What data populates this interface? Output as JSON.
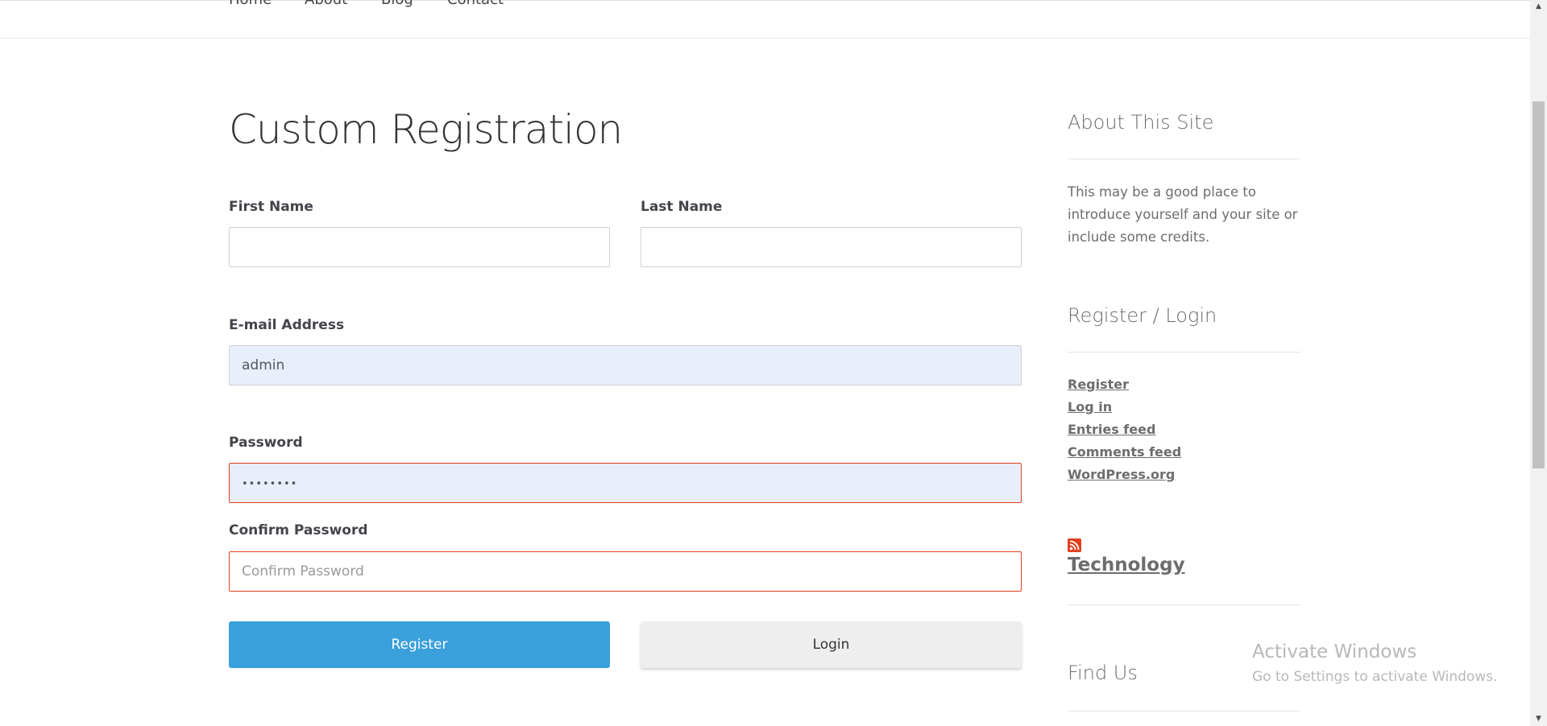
{
  "nav": {
    "items": [
      "Home",
      "About",
      "Blog",
      "Contact"
    ]
  },
  "page": {
    "title": "Custom Registration"
  },
  "form": {
    "first_name": {
      "label": "First Name",
      "value": ""
    },
    "last_name": {
      "label": "Last Name",
      "value": ""
    },
    "email": {
      "label": "E-mail Address",
      "value": "admin"
    },
    "password": {
      "label": "Password",
      "masked_value": "••••••••"
    },
    "confirm_password": {
      "label": "Confirm Password",
      "placeholder": "Confirm Password"
    },
    "register_label": "Register",
    "login_label": "Login"
  },
  "sidebar": {
    "about": {
      "title": "About This Site",
      "text": "This may be a good place to introduce yourself and your site or include some credits."
    },
    "register_login": {
      "title": "Register / Login",
      "links": [
        "Register",
        "Log in",
        "Entries feed",
        "Comments feed",
        "WordPress.org"
      ]
    },
    "rss": {
      "icon": "rss-icon",
      "title": "Technology"
    },
    "find_us": {
      "title": "Find Us"
    }
  },
  "watermark": {
    "title": "Activate Windows",
    "subtitle": "Go to Settings to activate Windows."
  },
  "colors": {
    "register_button": "#3aa0dc",
    "error_border": "#e2401c",
    "autofill_bg": "#e8effb"
  }
}
